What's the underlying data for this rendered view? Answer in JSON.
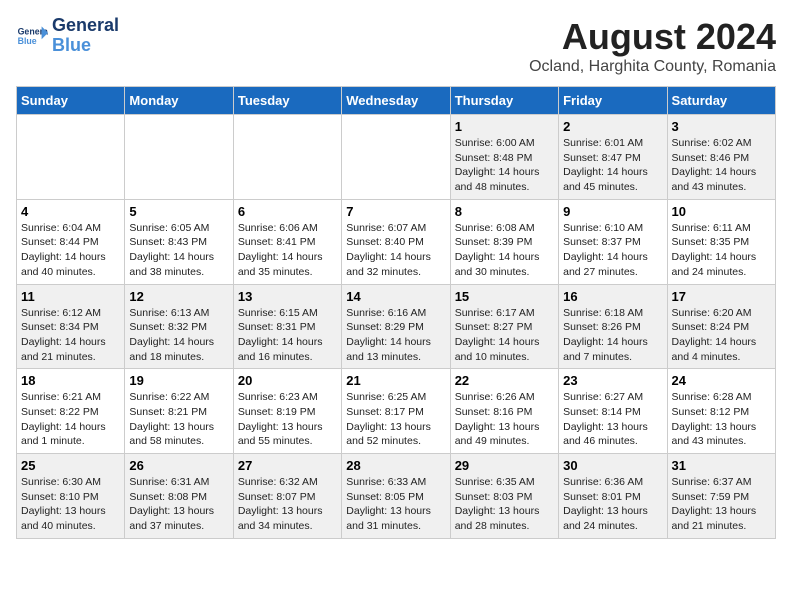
{
  "logo": {
    "line1": "General",
    "line2": "Blue"
  },
  "title": "August 2024",
  "subtitle": "Ocland, Harghita County, Romania",
  "columns": [
    "Sunday",
    "Monday",
    "Tuesday",
    "Wednesday",
    "Thursday",
    "Friday",
    "Saturday"
  ],
  "weeks": [
    [
      {
        "day": "",
        "info": ""
      },
      {
        "day": "",
        "info": ""
      },
      {
        "day": "",
        "info": ""
      },
      {
        "day": "",
        "info": ""
      },
      {
        "day": "1",
        "info": "Sunrise: 6:00 AM\nSunset: 8:48 PM\nDaylight: 14 hours and 48 minutes."
      },
      {
        "day": "2",
        "info": "Sunrise: 6:01 AM\nSunset: 8:47 PM\nDaylight: 14 hours and 45 minutes."
      },
      {
        "day": "3",
        "info": "Sunrise: 6:02 AM\nSunset: 8:46 PM\nDaylight: 14 hours and 43 minutes."
      }
    ],
    [
      {
        "day": "4",
        "info": "Sunrise: 6:04 AM\nSunset: 8:44 PM\nDaylight: 14 hours and 40 minutes."
      },
      {
        "day": "5",
        "info": "Sunrise: 6:05 AM\nSunset: 8:43 PM\nDaylight: 14 hours and 38 minutes."
      },
      {
        "day": "6",
        "info": "Sunrise: 6:06 AM\nSunset: 8:41 PM\nDaylight: 14 hours and 35 minutes."
      },
      {
        "day": "7",
        "info": "Sunrise: 6:07 AM\nSunset: 8:40 PM\nDaylight: 14 hours and 32 minutes."
      },
      {
        "day": "8",
        "info": "Sunrise: 6:08 AM\nSunset: 8:39 PM\nDaylight: 14 hours and 30 minutes."
      },
      {
        "day": "9",
        "info": "Sunrise: 6:10 AM\nSunset: 8:37 PM\nDaylight: 14 hours and 27 minutes."
      },
      {
        "day": "10",
        "info": "Sunrise: 6:11 AM\nSunset: 8:35 PM\nDaylight: 14 hours and 24 minutes."
      }
    ],
    [
      {
        "day": "11",
        "info": "Sunrise: 6:12 AM\nSunset: 8:34 PM\nDaylight: 14 hours and 21 minutes."
      },
      {
        "day": "12",
        "info": "Sunrise: 6:13 AM\nSunset: 8:32 PM\nDaylight: 14 hours and 18 minutes."
      },
      {
        "day": "13",
        "info": "Sunrise: 6:15 AM\nSunset: 8:31 PM\nDaylight: 14 hours and 16 minutes."
      },
      {
        "day": "14",
        "info": "Sunrise: 6:16 AM\nSunset: 8:29 PM\nDaylight: 14 hours and 13 minutes."
      },
      {
        "day": "15",
        "info": "Sunrise: 6:17 AM\nSunset: 8:27 PM\nDaylight: 14 hours and 10 minutes."
      },
      {
        "day": "16",
        "info": "Sunrise: 6:18 AM\nSunset: 8:26 PM\nDaylight: 14 hours and 7 minutes."
      },
      {
        "day": "17",
        "info": "Sunrise: 6:20 AM\nSunset: 8:24 PM\nDaylight: 14 hours and 4 minutes."
      }
    ],
    [
      {
        "day": "18",
        "info": "Sunrise: 6:21 AM\nSunset: 8:22 PM\nDaylight: 14 hours and 1 minute."
      },
      {
        "day": "19",
        "info": "Sunrise: 6:22 AM\nSunset: 8:21 PM\nDaylight: 13 hours and 58 minutes."
      },
      {
        "day": "20",
        "info": "Sunrise: 6:23 AM\nSunset: 8:19 PM\nDaylight: 13 hours and 55 minutes."
      },
      {
        "day": "21",
        "info": "Sunrise: 6:25 AM\nSunset: 8:17 PM\nDaylight: 13 hours and 52 minutes."
      },
      {
        "day": "22",
        "info": "Sunrise: 6:26 AM\nSunset: 8:16 PM\nDaylight: 13 hours and 49 minutes."
      },
      {
        "day": "23",
        "info": "Sunrise: 6:27 AM\nSunset: 8:14 PM\nDaylight: 13 hours and 46 minutes."
      },
      {
        "day": "24",
        "info": "Sunrise: 6:28 AM\nSunset: 8:12 PM\nDaylight: 13 hours and 43 minutes."
      }
    ],
    [
      {
        "day": "25",
        "info": "Sunrise: 6:30 AM\nSunset: 8:10 PM\nDaylight: 13 hours and 40 minutes."
      },
      {
        "day": "26",
        "info": "Sunrise: 6:31 AM\nSunset: 8:08 PM\nDaylight: 13 hours and 37 minutes."
      },
      {
        "day": "27",
        "info": "Sunrise: 6:32 AM\nSunset: 8:07 PM\nDaylight: 13 hours and 34 minutes."
      },
      {
        "day": "28",
        "info": "Sunrise: 6:33 AM\nSunset: 8:05 PM\nDaylight: 13 hours and 31 minutes."
      },
      {
        "day": "29",
        "info": "Sunrise: 6:35 AM\nSunset: 8:03 PM\nDaylight: 13 hours and 28 minutes."
      },
      {
        "day": "30",
        "info": "Sunrise: 6:36 AM\nSunset: 8:01 PM\nDaylight: 13 hours and 24 minutes."
      },
      {
        "day": "31",
        "info": "Sunrise: 6:37 AM\nSunset: 7:59 PM\nDaylight: 13 hours and 21 minutes."
      }
    ]
  ]
}
